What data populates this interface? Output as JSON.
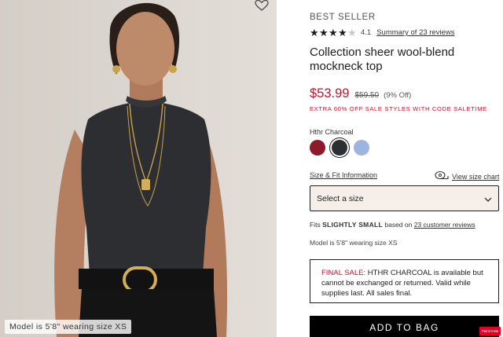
{
  "photo": {
    "model_tag": "Model is 5'8\" wearing size XS"
  },
  "product": {
    "badge": "BEST SELLER",
    "rating": {
      "value": "4.1",
      "stars_filled": 4,
      "stars_total": 5,
      "reviews_link": "Summary of 23 reviews"
    },
    "title": "Collection sheer wool-blend mockneck top",
    "price": {
      "sale": "$53.99",
      "original": "$59.50",
      "discount": "(9% Off)"
    },
    "promo": "EXTRA 60% OFF SALE STYLES WITH CODE SALETIME",
    "color": {
      "selected_label": "Hthr Charcoal",
      "swatches": [
        {
          "name": "red",
          "hex": "#8c1a2a"
        },
        {
          "name": "charcoal",
          "hex": "#2c2f34",
          "selected": true
        },
        {
          "name": "light-blue",
          "hex": "#9db4df"
        }
      ]
    },
    "size": {
      "fit_info_link": "Size & Fit Information",
      "size_chart_link": "View size chart",
      "select_label": "Select a size"
    },
    "fit": {
      "prefix": "Fits ",
      "emphasis": "SLIGHTLY SMALL",
      "middle": " based on ",
      "link": "23 customer reviews"
    },
    "model_info": "Model is 5'8\" wearing size XS",
    "final_sale": {
      "label": "FINAL SALE:",
      "text": " HTHR CHARCOAL is available but cannot be exchanged or returned. Valid while supplies last. All sales final."
    },
    "add_to_bag": "ADD TO BAG"
  },
  "overlay": {
    "pin_badge": "Paint It Me"
  },
  "colors": {
    "accent_red": "#c8102e",
    "button_bg": "#000000",
    "select_bg": "#f6efe9"
  }
}
